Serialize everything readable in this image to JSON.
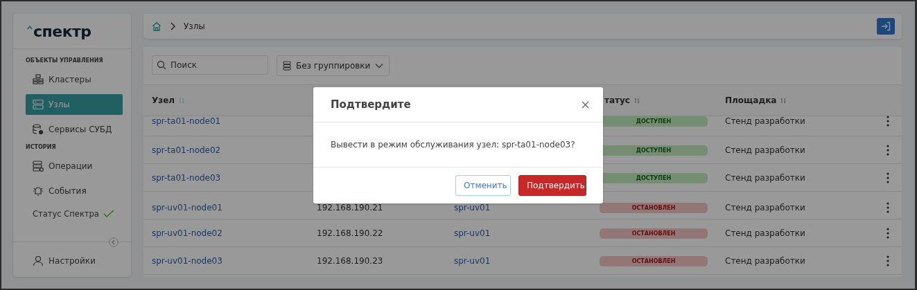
{
  "logo": {
    "text": "спектр"
  },
  "sidebar": {
    "sections": [
      {
        "title": "ОБЪЕКТЫ УПРАВЛЕНИЯ",
        "items": [
          {
            "label": "Кластеры",
            "selected": false
          },
          {
            "label": "Узлы",
            "selected": true
          },
          {
            "label": "Сервисы СУБД",
            "selected": false
          }
        ]
      },
      {
        "title": "ИСТОРИЯ",
        "items": [
          {
            "label": "Операции",
            "selected": false
          },
          {
            "label": "События",
            "selected": false
          }
        ]
      }
    ],
    "status": {
      "label": "Статус Спектра",
      "ok": true
    },
    "settings": {
      "label": "Настройки"
    }
  },
  "breadcrumb": {
    "current": "Узлы"
  },
  "toolbar": {
    "search": {
      "placeholder": "Поиск"
    },
    "grouping": {
      "value": "Без группировки"
    }
  },
  "table": {
    "columns": [
      {
        "label": "Узел"
      },
      {},
      {},
      {
        "label": "татус"
      },
      {
        "label": "Площадка"
      }
    ],
    "rows": [
      {
        "node": "spr-ta01-node01",
        "status": {
          "label": "ДОСТУПЕН",
          "kind": "ok"
        },
        "site": "Стенд разработки"
      },
      {
        "node": "spr-ta01-node02",
        "status": {
          "label": "ДОСТУПЕН",
          "kind": "ok"
        },
        "site": "Стенд разработки"
      },
      {
        "node": "spr-ta01-node03",
        "status": {
          "label": "ДОСТУПЕН",
          "kind": "ok"
        },
        "site": "Стенд разработки"
      },
      {
        "node": "spr-uv01-node01",
        "ip": "192.168.190.21",
        "cluster": "spr-uv01",
        "status": {
          "label": "ОСТАНОВЛЕН",
          "kind": "stopped"
        },
        "site": "Стенд разработки"
      },
      {
        "node": "spr-uv01-node02",
        "ip": "192.168.190.22",
        "cluster": "spr-uv01",
        "status": {
          "label": "ОСТАНОВЛЕН",
          "kind": "stopped"
        },
        "site": "Стенд разработки"
      },
      {
        "node": "spr-uv01-node03",
        "ip": "192.168.190.23",
        "cluster": "spr-uv01",
        "status": {
          "label": "ОСТАНОВЛЕН",
          "kind": "stopped"
        },
        "site": "Стенд разработки"
      }
    ]
  },
  "dialog": {
    "title": "Подтвердите",
    "message": "Вывести в режим обслуживания узел: spr-ta01-node03?",
    "buttons": [
      {
        "label": "Отменить",
        "kind": "secondary"
      },
      {
        "label": "Подтвердить",
        "kind": "primary"
      }
    ]
  }
}
